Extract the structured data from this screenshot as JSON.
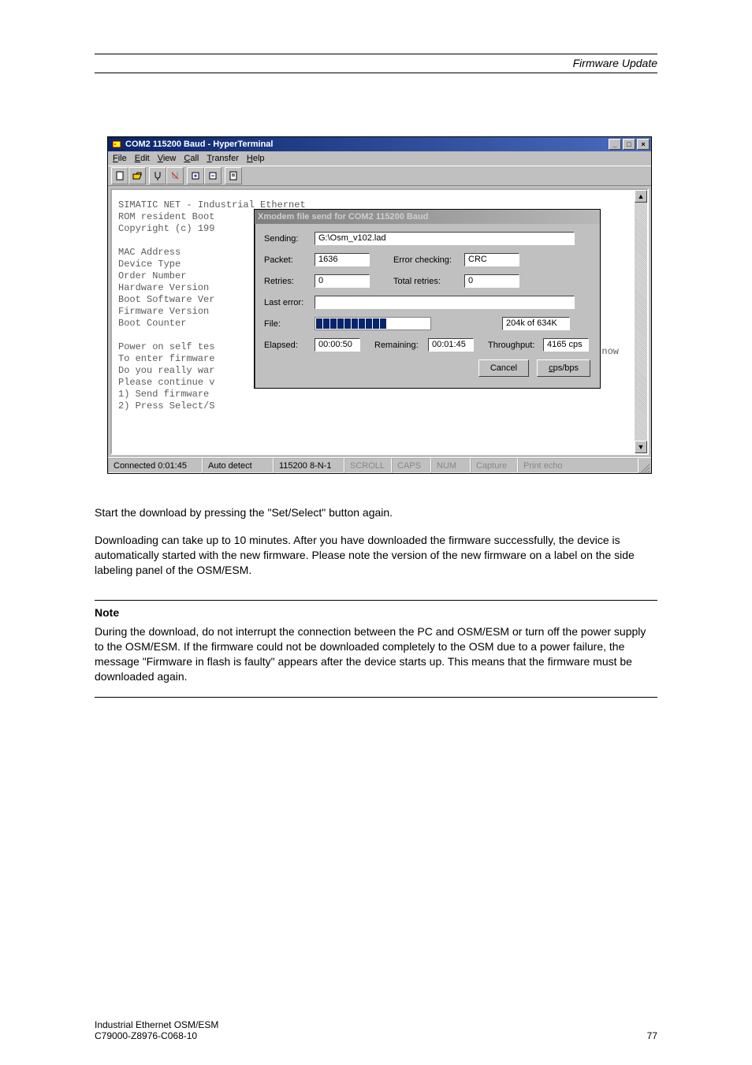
{
  "header": {
    "section_title": "Firmware Update"
  },
  "window": {
    "title": "COM2 115200 Baud - HyperTerminal",
    "menu": {
      "file": "File",
      "edit": "Edit",
      "view": "View",
      "call": "Call",
      "transfer": "Transfer",
      "help": "Help"
    },
    "terminal_lines": [
      "SIMATIC NET - Industrial Ethernet",
      "ROM resident Boot",
      "Copyright (c) 199",
      "",
      "MAC Address",
      "Device Type",
      "Order Number",
      "Hardware Version",
      "Boot Software Ver",
      "Firmware Version",
      "Boot Counter",
      "",
      "Power on self tes",
      "To enter firmware",
      "Do you really war",
      "Please continue v",
      "1) Send firmware ",
      "2) Press Select/S"
    ],
    "side_text": "now",
    "status": {
      "connected": "Connected 0:01:45",
      "detect": "Auto detect",
      "conn": "115200 8-N-1",
      "scroll": "SCROLL",
      "caps": "CAPS",
      "num": "NUM",
      "capture": "Capture",
      "echo": "Print echo"
    }
  },
  "dialog": {
    "title": "Xmodem file send for COM2 115200 Baud",
    "labels": {
      "sending": "Sending:",
      "packet": "Packet:",
      "error_checking": "Error checking:",
      "retries": "Retries:",
      "total_retries": "Total retries:",
      "last_error": "Last error:",
      "file": "File:",
      "elapsed": "Elapsed:",
      "remaining": "Remaining:",
      "throughput": "Throughput:"
    },
    "values": {
      "sending": "G:\\Osm_v102.lad",
      "packet": "1636",
      "error_checking": "CRC",
      "retries": "0",
      "total_retries": "0",
      "file_progress": "204k of 634K",
      "elapsed": "00:00:50",
      "remaining": "00:01:45",
      "throughput": "4165 cps"
    },
    "buttons": {
      "cancel": "Cancel",
      "cpsbps": "cps/bps"
    }
  },
  "body": {
    "p1": "Start the download by pressing the \"Set/Select\" button again.",
    "p2": "Downloading can take up to 10 minutes. After you have downloaded the firmware successfully, the device is automatically started with the new firmware. Please note the version of the new firmware on a label on the side labeling panel of the OSM/ESM.",
    "note_label": "Note",
    "note_text": "During the download, do not interrupt the connection between the PC and OSM/ESM or turn off the power supply to the OSM/ESM. If the firmware could not be downloaded completely to the OSM due to a power failure, the message \"Firmware in flash is faulty\" appears after the device starts up. This means that the firmware must be downloaded again."
  },
  "footer": {
    "left1": "Industrial Ethernet OSM/ESM",
    "left2": "C79000-Z8976-C068-10",
    "page": "77"
  }
}
